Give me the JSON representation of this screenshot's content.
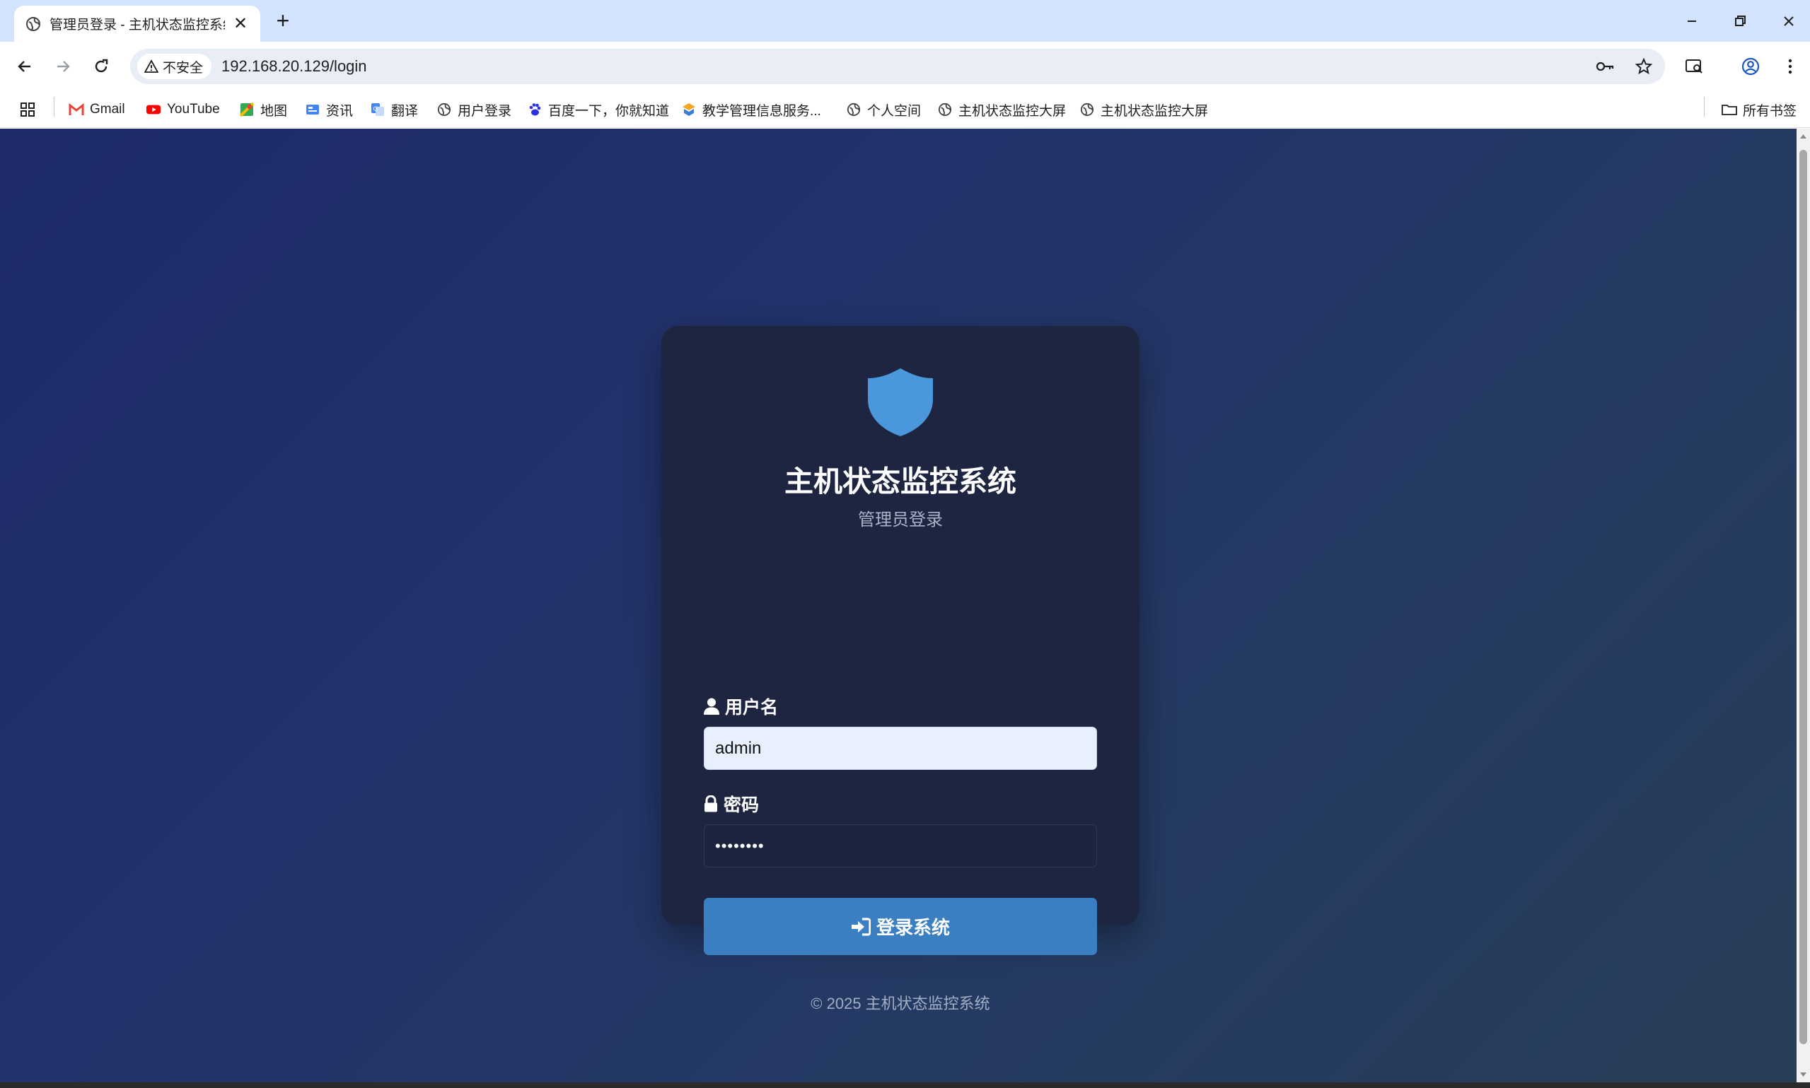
{
  "browser": {
    "tab_title": "管理员登录 - 主机状态监控系统",
    "tab_close": "✕",
    "new_tab": "+",
    "security_label": "不安全",
    "url": "192.168.20.129/login",
    "bookmarks": [
      {
        "label": "Gmail",
        "icon": "gmail-icon"
      },
      {
        "label": "YouTube",
        "icon": "youtube-icon"
      },
      {
        "label": "地图",
        "icon": "maps-icon"
      },
      {
        "label": "资讯",
        "icon": "news-icon"
      },
      {
        "label": "翻译",
        "icon": "translate-icon"
      },
      {
        "label": "用户登录",
        "icon": "globe-icon"
      },
      {
        "label": "百度一下，你就知道",
        "icon": "baidu-icon"
      },
      {
        "label": "教学管理信息服务...",
        "icon": "school-icon"
      },
      {
        "label": "个人空间",
        "icon": "globe-icon"
      },
      {
        "label": "主机状态监控大屏",
        "icon": "globe-icon"
      },
      {
        "label": "主机状态监控大屏",
        "icon": "globe-icon"
      }
    ],
    "all_bookmarks": "所有书签"
  },
  "login": {
    "title": "主机状态监控系统",
    "subtitle": "管理员登录",
    "username_label": "用户名",
    "username_value": "admin",
    "password_label": "密码",
    "password_value": "••••••••",
    "submit_label": "登录系统",
    "footer": "© 2025 主机状态监控系统"
  },
  "colors": {
    "background_start": "#1e2a6b",
    "background_end": "#283e58",
    "card": "#1e2541",
    "accent": "#3a7fc1",
    "shield": "#4a97dc"
  }
}
